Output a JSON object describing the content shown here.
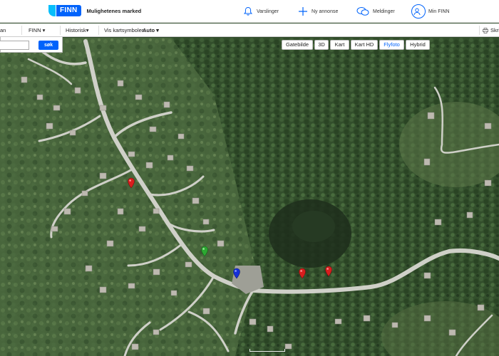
{
  "header": {
    "logo_text": "FINN",
    "tagline": "Mulighetenes marked",
    "nav": [
      {
        "label": "Varslinger",
        "icon": "bell-icon"
      },
      {
        "label": "Ny annonse",
        "icon": "plus-icon"
      },
      {
        "label": "Meldinger",
        "icon": "chat-icon"
      },
      {
        "label": "Min FINN",
        "icon": "user-avatar-icon"
      }
    ]
  },
  "toolbar": {
    "item_partial": "an",
    "finn_menu": "FINN ▾",
    "historisk_menu": "Historisk▾",
    "symbols_label": "Vis kartsymboler:",
    "symbols_value": "Auto ▾",
    "print_label": "Skri"
  },
  "search": {
    "placeholder": "",
    "button_label": "søk"
  },
  "map_types": [
    {
      "label": "Gatebilde",
      "active": false
    },
    {
      "label": "3D",
      "active": false
    },
    {
      "label": "Kart",
      "active": false
    },
    {
      "label": "Kart HD",
      "active": false
    },
    {
      "label": "Flyfoto",
      "active": true
    },
    {
      "label": "Hybrid",
      "active": false
    }
  ],
  "markers": [
    {
      "color": "#d81e1e",
      "icon": "red-map-pin"
    },
    {
      "color": "#2da832",
      "icon": "green-map-pin"
    },
    {
      "color": "#1530d8",
      "icon": "blue-map-pin"
    },
    {
      "color": "#d81e1e",
      "icon": "red-map-pin"
    },
    {
      "color": "#d81e1e",
      "icon": "red-map-pin"
    }
  ],
  "colors": {
    "accent": "#0063fb",
    "logo_light": "#06befb",
    "forest": "#2f4a2a"
  }
}
